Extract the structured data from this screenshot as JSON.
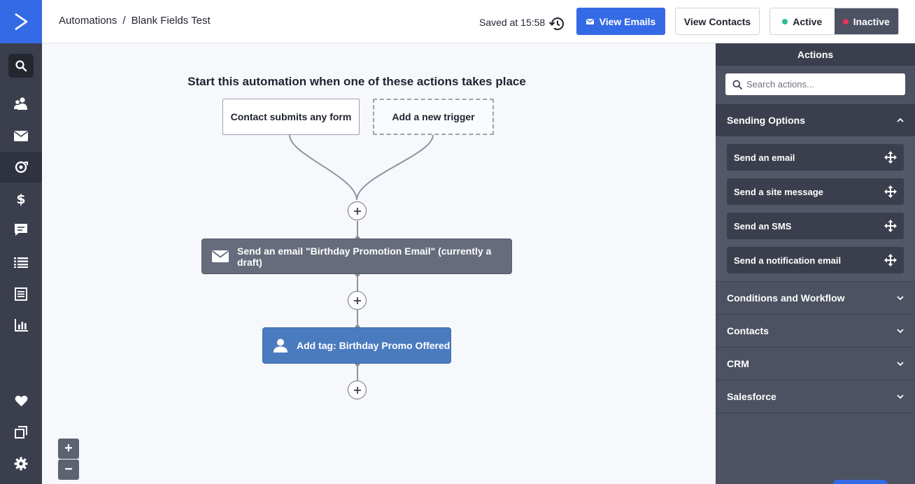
{
  "nav": {
    "items": [
      {
        "name": "search-icon"
      },
      {
        "name": "contacts-icon"
      },
      {
        "name": "campaigns-icon"
      },
      {
        "name": "automations-icon",
        "active": true
      },
      {
        "name": "deals-icon"
      },
      {
        "name": "conversations-icon"
      },
      {
        "name": "lists-icon"
      },
      {
        "name": "forms-icon"
      },
      {
        "name": "reports-icon"
      },
      {
        "name": "heart-icon"
      },
      {
        "name": "apps-icon"
      },
      {
        "name": "settings-icon"
      }
    ]
  },
  "header": {
    "breadcrumb_root": "Automations",
    "breadcrumb_sep": "/",
    "breadcrumb_current": "Blank Fields Test",
    "saved_text": "Saved at 15:58",
    "view_emails_label": "View Emails",
    "view_contacts_label": "View Contacts",
    "status_active_label": "Active",
    "status_inactive_label": "Inactive",
    "status_selected": "Inactive",
    "active_color": "#2dbf8f",
    "inactive_color": "#e9335a",
    "accent": "#356ae6"
  },
  "canvas": {
    "start_heading": "Start this automation when one of these actions takes place",
    "triggers": [
      {
        "label": "Contact submits any form"
      },
      {
        "label": "Add a new trigger"
      }
    ],
    "steps": [
      {
        "label": "Send an email \"Birthday Promotion Email\" (currently a draft)",
        "icon": "envelope-icon"
      },
      {
        "label": "Add tag: Birthday Promo Offered",
        "icon": "user-icon"
      }
    ],
    "zoom_in_label": "+",
    "zoom_out_label": "−"
  },
  "panel": {
    "title": "Actions",
    "search_placeholder": "Search actions...",
    "sections": [
      {
        "label": "Sending Options",
        "expanded": true,
        "items": [
          {
            "label": "Send an email"
          },
          {
            "label": "Send a site message"
          },
          {
            "label": "Send an SMS"
          },
          {
            "label": "Send a notification email"
          }
        ]
      },
      {
        "label": "Conditions and Workflow",
        "expanded": false
      },
      {
        "label": "Contacts",
        "expanded": false
      },
      {
        "label": "CRM",
        "expanded": false
      },
      {
        "label": "Salesforce",
        "expanded": false
      }
    ]
  }
}
